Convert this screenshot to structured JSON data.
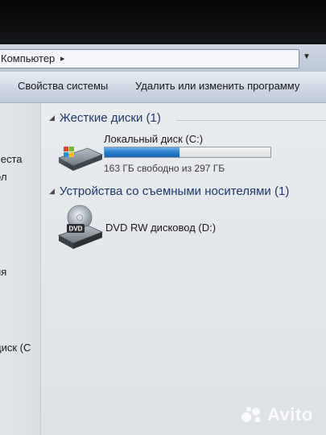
{
  "address_bar": {
    "path": "Компьютер",
    "chevron_icon": "chevron-right",
    "dropdown_icon": "chevron-down"
  },
  "command_bar": {
    "system_properties": "Свойства системы",
    "uninstall_program": "Удалить или изменить программу"
  },
  "nav_pane": {
    "items": [
      "честа",
      "ол",
      "ия",
      "диск (С"
    ]
  },
  "groups": [
    {
      "title": "Жесткие диски (1)",
      "drives": [
        {
          "name": "Локальный диск (C:)",
          "space_text": "163 ГБ свободно из 297 ГБ",
          "used_fraction": 0.45,
          "icon": "hard-drive-windows-icon"
        }
      ]
    },
    {
      "title": "Устройства со съемными носителями (1)",
      "drives": [
        {
          "name": "DVD RW дисковод (D:)",
          "icon_label": "DVD",
          "icon": "dvd-drive-icon"
        }
      ]
    }
  ],
  "watermark": {
    "text": "Avito"
  },
  "colors": {
    "group_header": "#1e3a6a",
    "usage_bar": "#2a7fcf",
    "background": "#e4e9ee"
  }
}
